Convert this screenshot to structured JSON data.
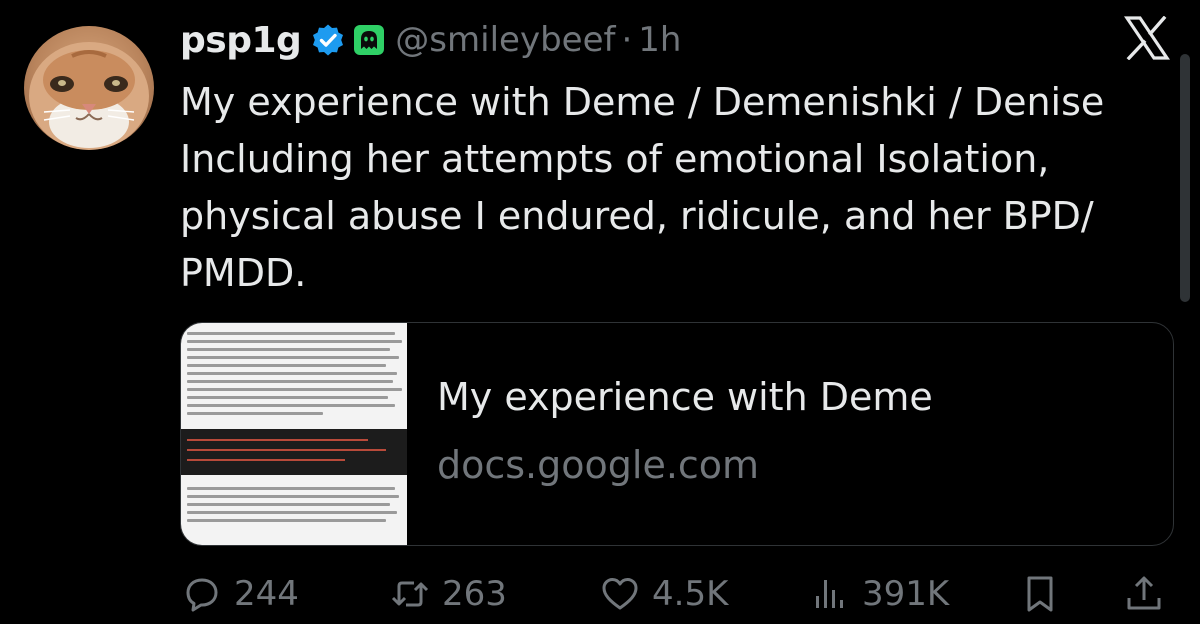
{
  "author": {
    "display_name": "psp1g",
    "handle": "@smileybeef",
    "separator": "·",
    "time": "1h",
    "verified_color": "#1d9bf0",
    "affiliate_badge_color": "#2fd066"
  },
  "tweet": {
    "lines": [
      "My experience with Deme / Demenishki / Denise",
      "Including her attempts of emotional Isolation,",
      "physical abuse I endured, ridicule, and her BPD/",
      "PMDD."
    ]
  },
  "link_card": {
    "title": "My experience with Deme",
    "domain": "docs.google.com"
  },
  "actions": {
    "replies": "244",
    "reposts": "263",
    "likes": "4.5K",
    "views": "391K"
  },
  "icons": [
    "x-logo-icon",
    "verified-check-icon",
    "ghost-icon",
    "reply-icon",
    "repost-icon",
    "like-heart-icon",
    "views-chart-icon",
    "bookmark-icon",
    "share-icon"
  ],
  "colors": {
    "background": "#000000",
    "text_primary": "#e7e9ea",
    "text_secondary": "#71767b",
    "border": "#2f3336"
  }
}
